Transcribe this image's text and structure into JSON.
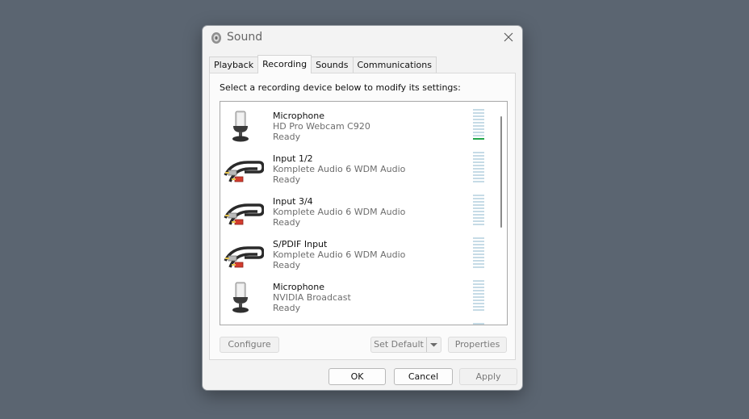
{
  "window": {
    "title": "Sound",
    "title_icon": "speaker-icon",
    "close_icon": "close-icon"
  },
  "tabs": [
    {
      "label": "Playback",
      "active": false
    },
    {
      "label": "Recording",
      "active": true
    },
    {
      "label": "Sounds",
      "active": false
    },
    {
      "label": "Communications",
      "active": false
    }
  ],
  "recording": {
    "instruction": "Select a recording device below to modify its settings:",
    "devices": [
      {
        "name": "Microphone",
        "description": "HD Pro Webcam C920",
        "status": "Ready",
        "icon": "microphone-icon",
        "level": 0.1
      },
      {
        "name": "Input 1/2",
        "description": "Komplete Audio 6 WDM Audio",
        "status": "Ready",
        "icon": "rca-cable-icon",
        "level": 0
      },
      {
        "name": "Input 3/4",
        "description": "Komplete Audio 6 WDM Audio",
        "status": "Ready",
        "icon": "rca-cable-icon",
        "level": 0
      },
      {
        "name": "S/PDIF Input",
        "description": "Komplete Audio 6 WDM Audio",
        "status": "Ready",
        "icon": "rca-cable-icon",
        "level": 0
      },
      {
        "name": "Microphone",
        "description": "NVIDIA Broadcast",
        "status": "Ready",
        "icon": "microphone-icon",
        "level": 0
      }
    ],
    "buttons": {
      "configure": "Configure",
      "set_default": "Set Default",
      "properties": "Properties"
    }
  },
  "footer": {
    "ok": "OK",
    "cancel": "Cancel",
    "apply": "Apply"
  },
  "colors": {
    "meter_idle": "#c6dbe6",
    "meter_active": "#22a64a"
  }
}
